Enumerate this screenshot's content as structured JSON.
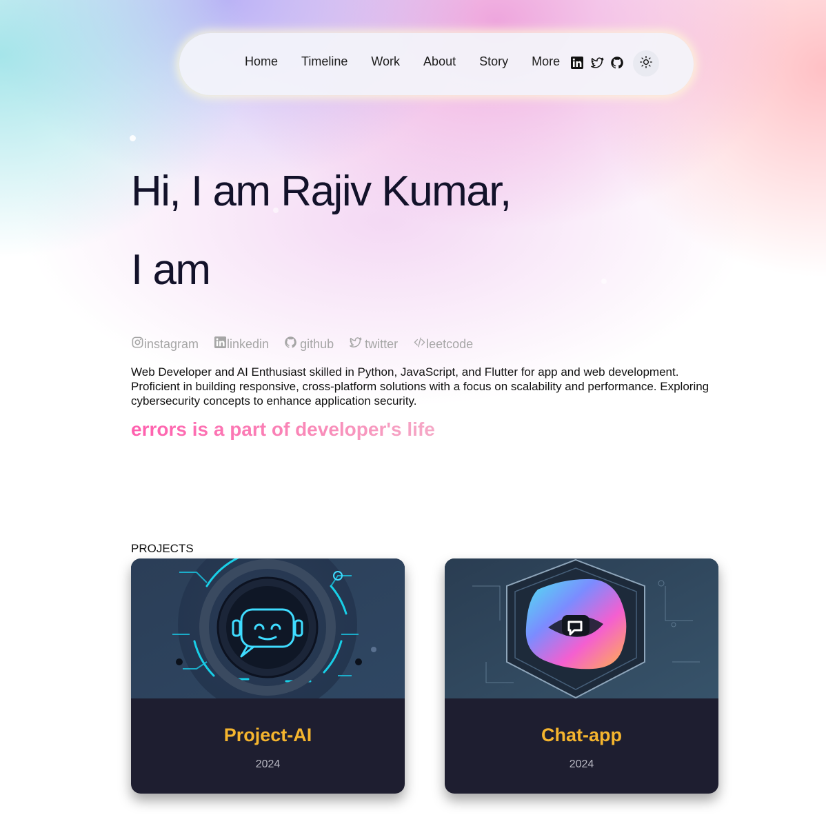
{
  "nav": {
    "links": [
      "Home",
      "Timeline",
      "Work",
      "About",
      "Story",
      "More"
    ],
    "icons": [
      "linkedin-icon",
      "twitter-icon",
      "github-icon"
    ],
    "theme_icon": "sun-icon"
  },
  "hero": {
    "greeting": "Hi, I am Rajiv Kumar,",
    "subtitle": "I am"
  },
  "socials": [
    {
      "icon": "instagram-icon",
      "label": "instagram"
    },
    {
      "icon": "linkedin-icon",
      "label": "linkedin"
    },
    {
      "icon": "github-icon",
      "label": "github"
    },
    {
      "icon": "twitter-icon",
      "label": "twitter"
    },
    {
      "icon": "code-icon",
      "label": "leetcode"
    }
  ],
  "bio": "Web Developer and AI Enthusiast skilled in Python, JavaScript, and Flutter for app and web development. Proficient in building responsive, cross-platform solutions with a focus on scalability and performance. Exploring cybersecurity concepts to enhance application security.",
  "quote": "errors is a part of developer's life",
  "projects": {
    "label": "PROJECTS",
    "items": [
      {
        "title": "Project-AI",
        "year": "2024",
        "image": "robot-ai-illustration"
      },
      {
        "title": "Chat-app",
        "year": "2024",
        "image": "chat-app-logo-illustration"
      }
    ]
  },
  "colors": {
    "accent_title": "#f5b52e",
    "quote_pink": "#ff5fae",
    "card_bg": "#1e1e30"
  }
}
